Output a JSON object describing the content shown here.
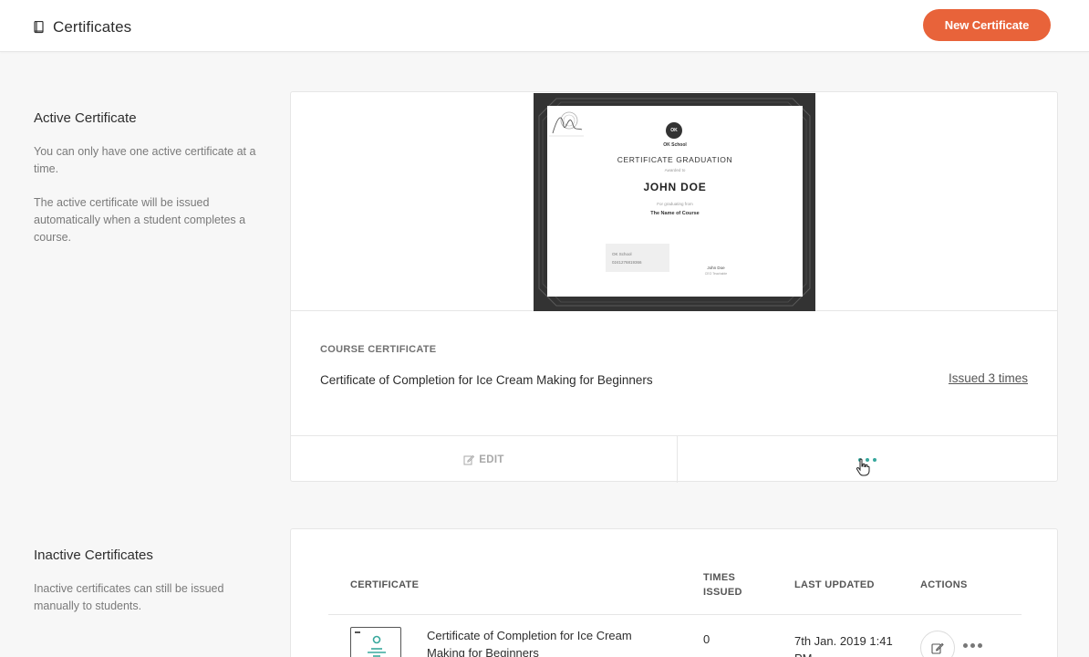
{
  "header": {
    "title": "Certificates",
    "new_button": "New Certificate",
    "accent": "#e8633a"
  },
  "active_section": {
    "heading": "Active Certificate",
    "desc1": "You can only have one active certificate at a time.",
    "desc2": "The active certificate will be issued automatically when a student completes a course."
  },
  "certificate_preview": {
    "logo": "OK",
    "school": "OK School",
    "title": "CERTIFICATE GRADUATION",
    "awarded": "Awarded to",
    "recipient": "JOHN DOE",
    "for_text": "For graduating from",
    "course": "The Name of Course",
    "id_school": "OK School",
    "id_number": "0241276819366",
    "signer": "John Doe",
    "signer_role": "CEO Teachable"
  },
  "active_card": {
    "type_label": "COURSE CERTIFICATE",
    "name": "Certificate of Completion for Ice Cream Making for Beginners",
    "issued": "Issued 3 times",
    "edit_label": "EDIT"
  },
  "inactive_section": {
    "heading": "Inactive Certificates",
    "desc": "Inactive certificates can still be issued manually to students."
  },
  "table": {
    "columns": [
      "CERTIFICATE",
      "TIMES ISSUED",
      "LAST UPDATED",
      "ACTIONS"
    ],
    "rows": [
      {
        "name": "Certificate of Completion for Ice Cream Making for Beginners",
        "times": "0",
        "updated": "7th Jan. 2019 1:41 PM"
      }
    ]
  },
  "icons": {
    "book": "book-icon",
    "pencil": "pencil-icon",
    "more": "more-dots-icon",
    "cursor": "hand-cursor-icon"
  },
  "colors": {
    "teal": "#38a89d",
    "orange": "#e8633a"
  }
}
